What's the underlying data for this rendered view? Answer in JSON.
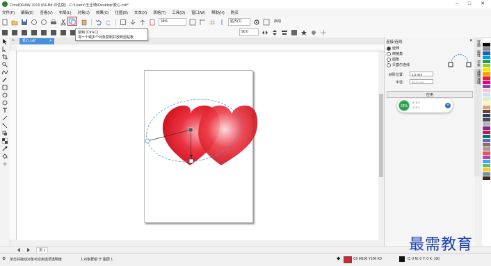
{
  "app": {
    "title": "CorelDRAW 2019 (64-Bit 评估版) - C:\\Users\\王玉琦\\Desktop\\爱心.cdr*"
  },
  "menu": [
    "文件(F)",
    "编辑(E)",
    "查看(V)",
    "布局(L)",
    "对象(J)",
    "效果(C)",
    "位图(B)",
    "文本(X)",
    "表格(T)",
    "工具(O)",
    "窗口(W)",
    "帮助(H)",
    "购买"
  ],
  "toolbar": {
    "zoom": "34%",
    "snap_label": "贴齐(T)",
    "launch_label": "启动",
    "rotation": "90.0"
  },
  "tooltip": {
    "title": "复制 (Ctrl+C)",
    "description": "将一个或多个对象复制并放到剪贴板"
  },
  "doc_tab": "爱心.cdr*",
  "docker": {
    "title": "连接/连线",
    "options": [
      {
        "label": "延伸",
        "selected": true
      },
      {
        "label": "倒棱角",
        "selected": false
      },
      {
        "label": "圆角",
        "selected": false
      },
      {
        "label": "贝塞尔连线",
        "selected": false
      }
    ],
    "field1_label": "斜阶位置:",
    "field1_value": "1.0 mm",
    "field2_label": "半径:",
    "field2_value": "10.0 mm",
    "apply_label": "应用",
    "progress_pct": "28%",
    "progress_value": 0.28,
    "values": [
      "X: 0.1",
      "Y: 0.1"
    ]
  },
  "side_tabs": [
    "变换",
    "属性",
    "对象",
    "连接/连线"
  ],
  "page_tab": "页 1",
  "status": {
    "hint": "单击并拖动对象可应用选项透明度",
    "selection": "1 对象群组 于 图层 1",
    "fill": "C0 M100 Y100 K0",
    "outline": "C: 0 M: 0 Y: 0 K: 100"
  },
  "colors": {
    "heart_red": "#e3202d",
    "highlight": "#e03131",
    "accent_blue": "#4a90d9",
    "badge_green": "#2e9e4f"
  },
  "watermark": "最需教育"
}
